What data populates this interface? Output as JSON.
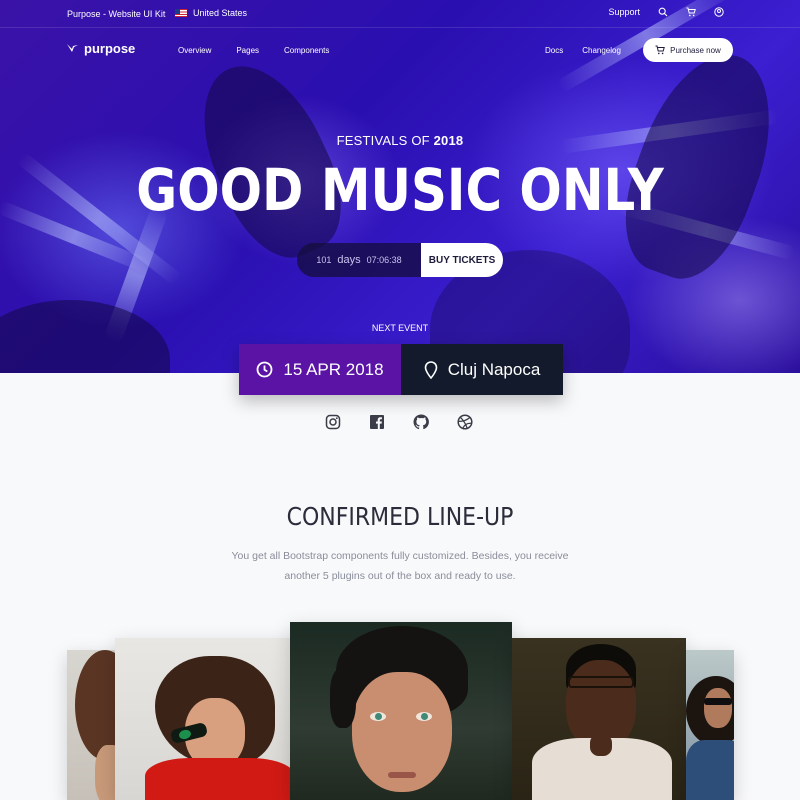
{
  "topbar": {
    "brand_text": "Purpose - Website UI Kit",
    "country": "United States",
    "support": "Support",
    "icons": [
      "search-icon",
      "cart-icon",
      "user-icon"
    ]
  },
  "nav": {
    "logo_text": "purpose",
    "links": [
      "Overview",
      "Pages",
      "Components"
    ],
    "right_links": [
      "Docs",
      "Changelog"
    ],
    "purchase_label": "Purchase now"
  },
  "hero": {
    "festivals_prefix": "FESTIVALS OF",
    "festivals_year": "2018",
    "headline": "GOOD MUSIC ONLY",
    "countdown_days_value": "101",
    "countdown_days_label": "days",
    "countdown_time": "07:06:38",
    "buy_label": "BUY TICKETS",
    "next_event_label": "NEXT EVENT"
  },
  "event": {
    "date": "15 APR 2018",
    "location": "Cluj Napoca"
  },
  "social": [
    "instagram-icon",
    "facebook-icon",
    "github-icon",
    "dribbble-icon"
  ],
  "lineup": {
    "title": "CONFIRMED LINE-UP",
    "description": "You get all Bootstrap components fully customized. Besides, you receive another 5 plugins out of the box and ready to use."
  },
  "colors": {
    "hero_bg": "#3a12a8",
    "date_bg": "#5b13a6",
    "location_bg": "#131a2b",
    "page_bg": "#f8f9fb"
  }
}
